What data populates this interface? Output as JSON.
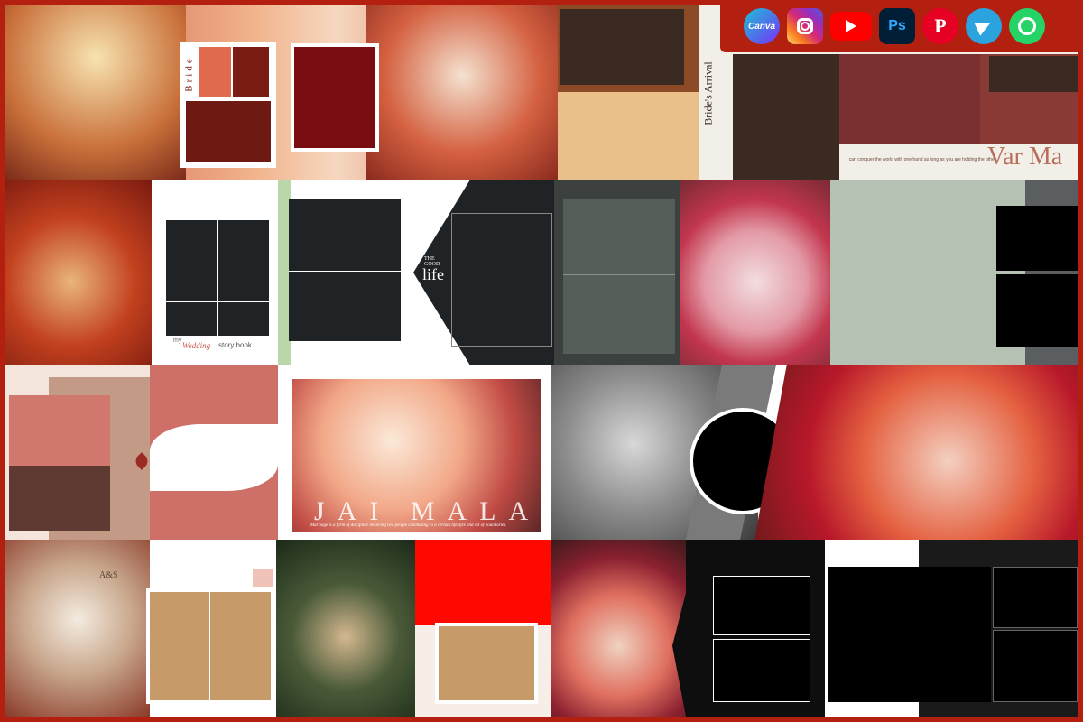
{
  "social": {
    "canva": "Canva",
    "instagram": "instagram-icon",
    "youtube": "youtube-icon",
    "photoshop": "Ps",
    "pinterest": "P",
    "telegram": "telegram-icon",
    "whatsapp": "whatsapp-icon"
  },
  "tiles": {
    "bride_label": "Bride",
    "brides_arrival": "Bride's Arrival",
    "conquer_quote": "I can conquer the world with one hand as long as you are holding the other",
    "var_mala": "Var Ma",
    "storybook_my": "my",
    "storybook_wedding": "Wedding",
    "storybook_book": "story book",
    "good_life_the": "THE",
    "good_life_good": "GOOD",
    "good_life_life": "life",
    "jai_mala": "JAI MALA",
    "jai_mala_quote": "Marriage is a form of discipline involving two people committing to a certain lifestyle and set of boundaries.",
    "monogram": "A&S"
  },
  "colors": {
    "brand_red": "#b3200f",
    "maroon": "#6e0f0f",
    "brown": "#3a2a22",
    "tan": "#c79a6a",
    "sage": "#b5c1b3",
    "rose": "#cf7068",
    "dark_slot": "#1f2326"
  }
}
